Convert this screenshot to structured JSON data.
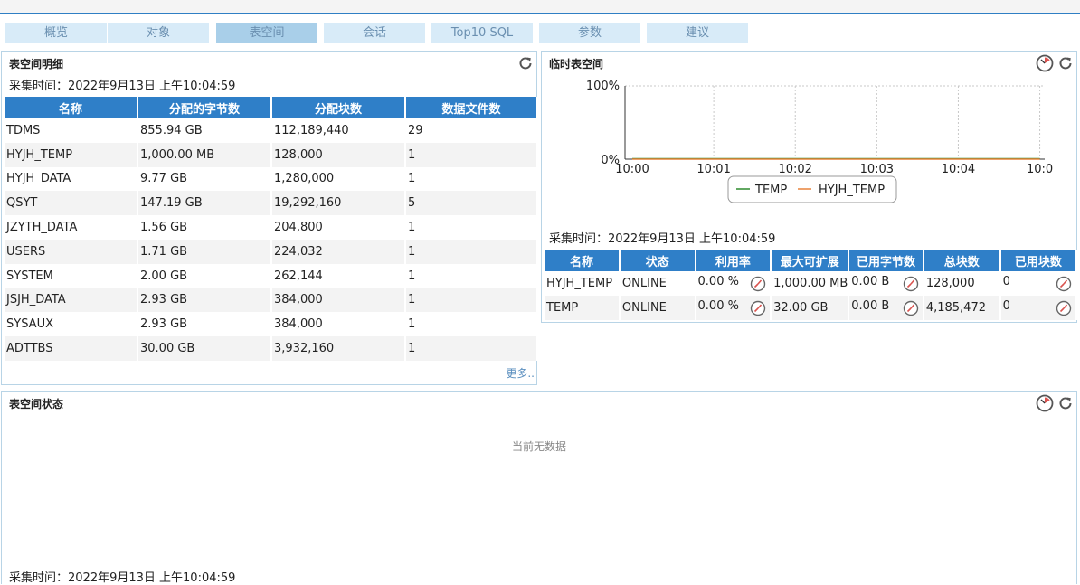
{
  "tabs": [
    {
      "label": "概览",
      "active": false
    },
    {
      "label": "对象",
      "active": false
    },
    {
      "label": "表空间",
      "active": true
    },
    {
      "label": "会话",
      "active": false
    },
    {
      "label": "Top10 SQL",
      "active": false
    },
    {
      "label": "参数",
      "active": false
    },
    {
      "label": "建议",
      "active": false
    }
  ],
  "detail": {
    "title": "表空间明细",
    "collect_time": "采集时间：2022年9月13日 上午10:04:59",
    "columns": [
      "名称",
      "分配的字节数",
      "分配块数",
      "数据文件数"
    ],
    "rows": [
      [
        "TDMS",
        "855.94 GB",
        "112,189,440",
        "29"
      ],
      [
        "HYJH_TEMP",
        "1,000.00 MB",
        "128,000",
        "1"
      ],
      [
        "HYJH_DATA",
        "9.77 GB",
        "1,280,000",
        "1"
      ],
      [
        "QSYT",
        "147.19 GB",
        "19,292,160",
        "5"
      ],
      [
        "JZYTH_DATA",
        "1.56 GB",
        "204,800",
        "1"
      ],
      [
        "USERS",
        "1.71 GB",
        "224,032",
        "1"
      ],
      [
        "SYSTEM",
        "2.00 GB",
        "262,144",
        "1"
      ],
      [
        "JSJH_DATA",
        "2.93 GB",
        "384,000",
        "1"
      ],
      [
        "SYSAUX",
        "2.93 GB",
        "384,000",
        "1"
      ],
      [
        "ADTTBS",
        "30.00 GB",
        "3,932,160",
        "1"
      ]
    ],
    "more_label": "更多.."
  },
  "temp": {
    "title": "临时表空间",
    "collect_time": "采集时间：2022年9月13日 上午10:04:59",
    "columns": [
      "名称",
      "状态",
      "利用率",
      "最大可扩展",
      "已用字节数",
      "总块数",
      "已用块数"
    ],
    "rows": [
      [
        "HYJH_TEMP",
        "ONLINE",
        "0.00 %",
        "1,000.00 MB",
        "0.00 B",
        "128,000",
        "0"
      ],
      [
        "TEMP",
        "ONLINE",
        "0.00 %",
        "32.00 GB",
        "0.00 B",
        "4,185,472",
        "0"
      ]
    ]
  },
  "chart_data": {
    "type": "line",
    "x": [
      "10:00",
      "10:01",
      "10:02",
      "10:03",
      "10:04",
      "10:0"
    ],
    "y_ticks": [
      "100%",
      "0%"
    ],
    "ylim": [
      0,
      100
    ],
    "series": [
      {
        "name": "TEMP",
        "color": "#2e8b2e",
        "values": [
          0,
          0,
          0,
          0,
          0,
          0
        ]
      },
      {
        "name": "HYJH_TEMP",
        "color": "#e8833a",
        "values": [
          0,
          0,
          0,
          0,
          0,
          0
        ]
      }
    ],
    "grid": true,
    "legend": "bottom"
  },
  "status": {
    "title": "表空间状态",
    "no_data": "当前无数据",
    "collect_time": "采集时间：2022年9月13日 上午10:04:59"
  }
}
